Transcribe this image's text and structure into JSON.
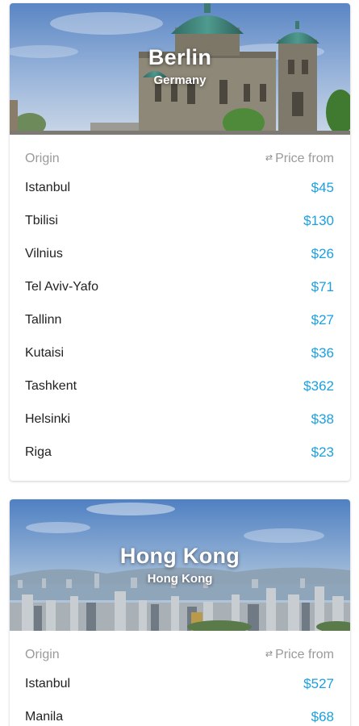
{
  "colors": {
    "accent_price": "#1ba0e1",
    "header_text": "#9a9a9a",
    "body_text": "#222222"
  },
  "destinations": [
    {
      "city": "Berlin",
      "country": "Germany",
      "image_icon": "berlin-cathedral-photo",
      "origin_header": "Origin",
      "price_header": "Price from",
      "rows": [
        {
          "origin": "Istanbul",
          "price": "$45"
        },
        {
          "origin": "Tbilisi",
          "price": "$130"
        },
        {
          "origin": "Vilnius",
          "price": "$26"
        },
        {
          "origin": "Tel Aviv-Yafo",
          "price": "$71"
        },
        {
          "origin": "Tallinn",
          "price": "$27"
        },
        {
          "origin": "Kutaisi",
          "price": "$36"
        },
        {
          "origin": "Tashkent",
          "price": "$362"
        },
        {
          "origin": "Helsinki",
          "price": "$38"
        },
        {
          "origin": "Riga",
          "price": "$23"
        }
      ]
    },
    {
      "city": "Hong Kong",
      "country": "Hong Kong",
      "image_icon": "hong-kong-skyline-photo",
      "origin_header": "Origin",
      "price_header": "Price from",
      "rows": [
        {
          "origin": "Istanbul",
          "price": "$527"
        },
        {
          "origin": "Manila",
          "price": "$68"
        }
      ]
    }
  ]
}
